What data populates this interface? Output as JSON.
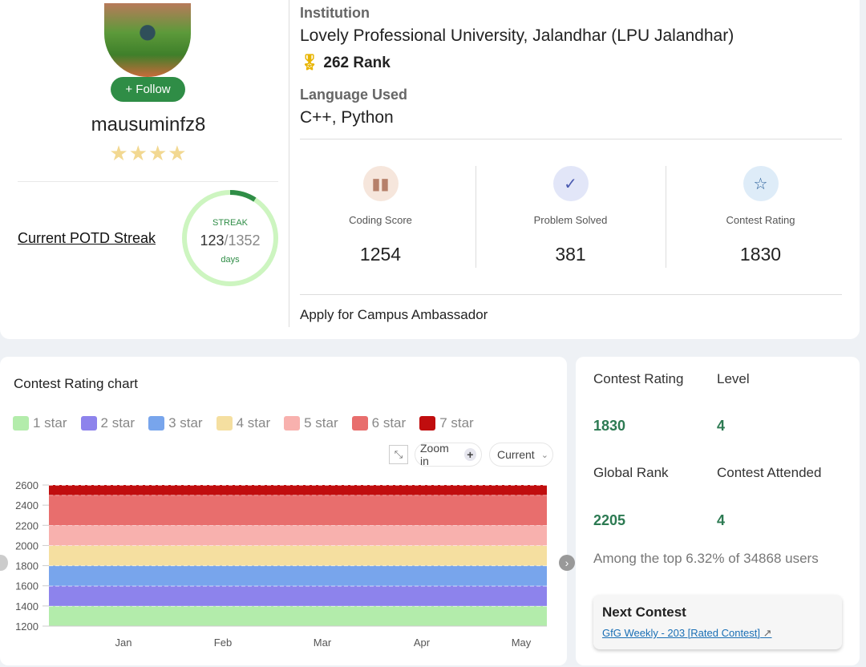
{
  "profile": {
    "username": "mausuminfz8",
    "follow_label": "+ Follow",
    "stars": "★★★★",
    "potd_label": "Current POTD Streak",
    "streak_label": "STREAK",
    "streak_current": "123",
    "streak_total": "/1352",
    "streak_unit": "days",
    "streak_fraction": 0.091
  },
  "institution": {
    "label": "Institution",
    "value": "Lovely Professional University, Jalandhar (LPU Jalandhar)",
    "rank": "262 Rank"
  },
  "language": {
    "label": "Language Used",
    "value": "C++, Python"
  },
  "stats": [
    {
      "label": "Coding Score",
      "value": "1254",
      "icon": "bar-chart-icon"
    },
    {
      "label": "Problem Solved",
      "value": "381",
      "icon": "check-circle-icon"
    },
    {
      "label": "Contest Rating",
      "value": "1830",
      "icon": "star-icon"
    }
  ],
  "campus": "Apply for Campus Ambassador",
  "chart_title": "Contest Rating chart",
  "controls": {
    "zoom": "Zoom in",
    "range": "Current"
  },
  "chart_data": {
    "type": "area",
    "title": "Contest Rating chart",
    "xlabel": "",
    "ylabel": "",
    "categories": [
      "Jan",
      "Feb",
      "Mar",
      "Apr",
      "May"
    ],
    "ylim": [
      1200,
      2600
    ],
    "yticks": [
      1200,
      1400,
      1600,
      1800,
      2000,
      2200,
      2400,
      2600
    ],
    "bands": [
      {
        "name": "1 star",
        "from": 1200,
        "to": 1400,
        "color": "#b3ecab"
      },
      {
        "name": "2 star",
        "from": 1400,
        "to": 1600,
        "color": "#8d83ec"
      },
      {
        "name": "3 star",
        "from": 1600,
        "to": 1800,
        "color": "#78a5ec"
      },
      {
        "name": "4 star",
        "from": 1800,
        "to": 2000,
        "color": "#f5dfa0"
      },
      {
        "name": "5 star",
        "from": 2000,
        "to": 2200,
        "color": "#f8b1ae"
      },
      {
        "name": "6 star",
        "from": 2200,
        "to": 2500,
        "color": "#e86e6d"
      },
      {
        "name": "7 star",
        "from": 2500,
        "to": 2600,
        "color": "#c00d0e"
      }
    ],
    "legend": "top-left"
  },
  "summary": {
    "rating_label": "Contest Rating",
    "rating": "1830",
    "level_label": "Level",
    "level": "4",
    "rank_label": "Global Rank",
    "rank": "2205",
    "attended_label": "Contest Attended",
    "attended": "4",
    "top_text": "Among the top 6.32% of 34868 users"
  },
  "next_contest": {
    "title": "Next Contest",
    "link": "GfG Weekly - 203 [Rated Contest]"
  }
}
